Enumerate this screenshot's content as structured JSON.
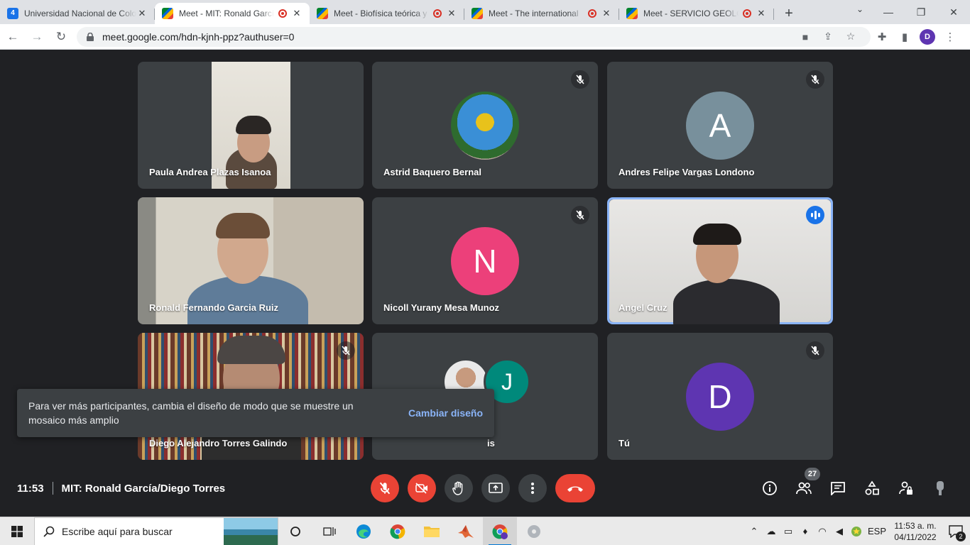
{
  "browser": {
    "tabs": [
      {
        "title": "Universidad Nacional de Colombia",
        "favicon": "calendar-icon",
        "favicon_text": "4",
        "recording": false
      },
      {
        "title": "Meet - MIT: Ronald García/Diego Torres",
        "favicon": "meet-icon",
        "recording": true
      },
      {
        "title": "Meet - Biofísica teórica y",
        "favicon": "meet-icon",
        "recording": true
      },
      {
        "title": "Meet - The international",
        "favicon": "meet-icon",
        "recording": true
      },
      {
        "title": "Meet - SERVICIO GEOLÓGICO",
        "favicon": "meet-icon",
        "recording": true
      }
    ],
    "url": "meet.google.com/hdn-kjnh-ppz?authuser=0",
    "profile_initial": "D"
  },
  "participants": [
    {
      "name": "Paula Andrea Plazas Isanoa",
      "type": "video",
      "muted": false
    },
    {
      "name": "Astrid Baquero Bernal",
      "type": "photo",
      "muted": true
    },
    {
      "name": "Andres Felipe Vargas Londono",
      "type": "initial",
      "initial": "A",
      "color": "#78909c",
      "muted": true
    },
    {
      "name": "Ronald Fernando Garcia Ruiz",
      "type": "video",
      "muted": false
    },
    {
      "name": "Nicoll Yurany Mesa Munoz",
      "type": "initial",
      "initial": "N",
      "color": "#ec407a",
      "muted": true
    },
    {
      "name": "Angel Cruz",
      "type": "video",
      "muted": false,
      "speaking": true
    },
    {
      "name": "Diego Alejandro Torres Galindo",
      "type": "video",
      "muted": true
    },
    {
      "name": "is",
      "type": "group",
      "initial": "J",
      "color": "#00897b",
      "muted": false
    },
    {
      "name": "Tú",
      "type": "initial",
      "initial": "D",
      "color": "#5e35b1",
      "muted": true
    }
  ],
  "toast": {
    "message": "Para ver más participantes, cambia el diseño de modo que se muestre un mosaico más amplio",
    "action": "Cambiar diseño"
  },
  "meeting": {
    "time": "11:53",
    "title": "MIT: Ronald García/Diego Torres",
    "participant_count": "27"
  },
  "taskbar": {
    "search_placeholder": "Escribe aquí para buscar",
    "language": "ESP",
    "time": "11:53 a. m.",
    "date": "04/11/2022",
    "notifications": "2"
  },
  "colors": {
    "meet_bg": "#202124",
    "tile_bg": "#3c4043",
    "red": "#ea4335",
    "accent": "#8ab4f8"
  }
}
